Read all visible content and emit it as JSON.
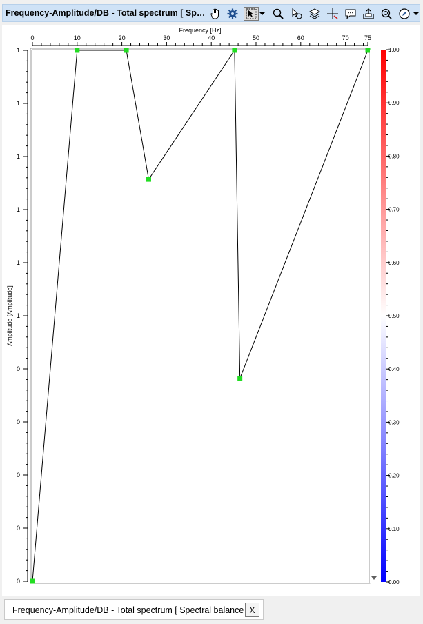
{
  "window": {
    "title": "Frequency-Amplitude/DB - Total spectrum [ Spec...",
    "tab_label": "Frequency-Amplitude/DB - Total spectrum [ Spectral balance ]",
    "tab_close": "X"
  },
  "toolbar": {
    "icons": [
      "pan-hand-icon",
      "settings-gear-icon",
      "select-arrow-icon",
      "zoom-magnifier-icon",
      "pointer-pick-icon",
      "layers-icon",
      "crosshair-icon",
      "annotation-comment-icon",
      "export-icon",
      "target-zoom-icon",
      "compass-icon"
    ]
  },
  "chart_data": {
    "type": "line",
    "xlabel": "Frequency [Hz]",
    "ylabel": "Amplitude [Amplitude]",
    "xlim": [
      0,
      75
    ],
    "x_ticks": [
      "0",
      "10",
      "20",
      "30",
      "40",
      "50",
      "60",
      "70",
      "75"
    ],
    "y_ticks": [
      "1",
      "1",
      "1",
      "1",
      "1",
      "1",
      "0",
      "0",
      "0",
      "0",
      "0"
    ],
    "ylim": [
      0,
      1
    ],
    "points": [
      {
        "x": 0,
        "y": 0.0
      },
      {
        "x": 10,
        "y": 1.0
      },
      {
        "x": 21,
        "y": 1.0
      },
      {
        "x": 26,
        "y": 0.757
      },
      {
        "x": 45.2,
        "y": 1.0
      },
      {
        "x": 46.4,
        "y": 0.382
      },
      {
        "x": 75,
        "y": 1.0
      }
    ],
    "line_color": "#000000",
    "marker_color": "#22dd22",
    "colorbar": {
      "ticks": [
        "1.00",
        "0.90",
        "0.80",
        "0.70",
        "0.60",
        "0.50",
        "0.40",
        "0.30",
        "0.20",
        "0.10",
        "0.00"
      ],
      "top_color": "#ff0000",
      "mid_color": "#ffffff",
      "bottom_color": "#0000ff"
    }
  }
}
